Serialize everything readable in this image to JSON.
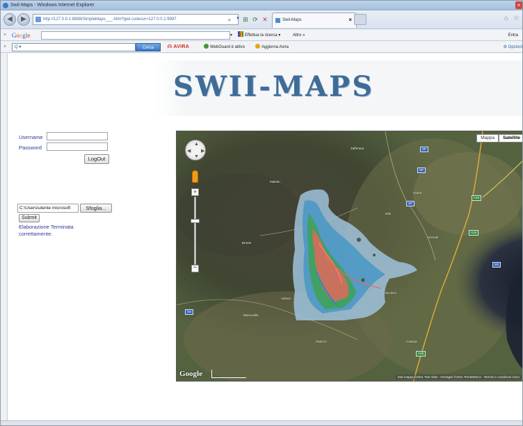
{
  "window": {
    "title": "Swii-Maps - Windows Internet Explorer"
  },
  "browser": {
    "url": "http://127.0.0.1:8888/SimpleMaps___.html?gwt.codesvr=127.0.0.1:9997",
    "tab_title": "Swii-Maps"
  },
  "google_toolbar": {
    "logo": "Google",
    "search_label": "Effettua la ricerca",
    "more_label": "Altro »",
    "signin_label": "Entra"
  },
  "avira_toolbar": {
    "search_value": "Q ▾",
    "search_button": "Cerca",
    "logo": "AVIRA",
    "webguard": "WebGuard è attivo",
    "update": "Aggiorna Avira",
    "options": "Opzioni"
  },
  "page": {
    "title": "SWII-MAPS",
    "login": {
      "username_label": "Username",
      "password_label": "Password",
      "logout_button": "LogOut"
    },
    "upload": {
      "file_path": "C:\\Users\\utente microsoft",
      "browse_button": "Sfoglia...",
      "submit_button": "Submit",
      "status": "Elaborazione Terminata correttamente."
    },
    "map": {
      "type_buttons": [
        "Mappa",
        "Satellite"
      ],
      "selected_type": "Satellite",
      "logo": "Google",
      "copyright": "Dati mappa ©2011 Tele Atlas - Immagini ©2011 TerraMetrics - Termini e condizioni d'uso"
    }
  },
  "colors": {
    "title_blue": "#3f6c97",
    "link_blue": "#2b3a95"
  }
}
